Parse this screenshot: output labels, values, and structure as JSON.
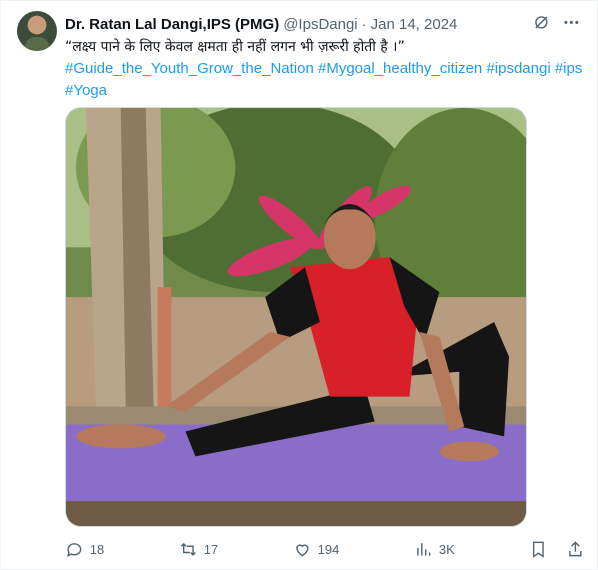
{
  "tweet": {
    "author_name": "Dr. Ratan Lal Dangi,IPS (PMG)",
    "handle": "@IpsDangi",
    "separator": "·",
    "date": "Jan 14, 2024",
    "quote": "“लक्ष्य पाने के लिए केवल क्षमता ही नहीं लगन भी ज़रूरी होती है ।”",
    "hashtags": [
      "#Guide_the_Youth_Grow_the_Nation",
      "#Mygoal_healthy_citizen",
      "#ipsdangi",
      "#ips",
      "#Yoga"
    ]
  },
  "header_icons": [
    "grok-icon",
    "more-icon"
  ],
  "metrics": {
    "replies": "18",
    "reposts": "17",
    "likes": "194",
    "views": "3K"
  },
  "colors": {
    "link": "#1d9bf0",
    "muted": "#536471",
    "text": "#0f1419",
    "mat": "#8a6cc9",
    "shirt_red": "#d8202a"
  }
}
